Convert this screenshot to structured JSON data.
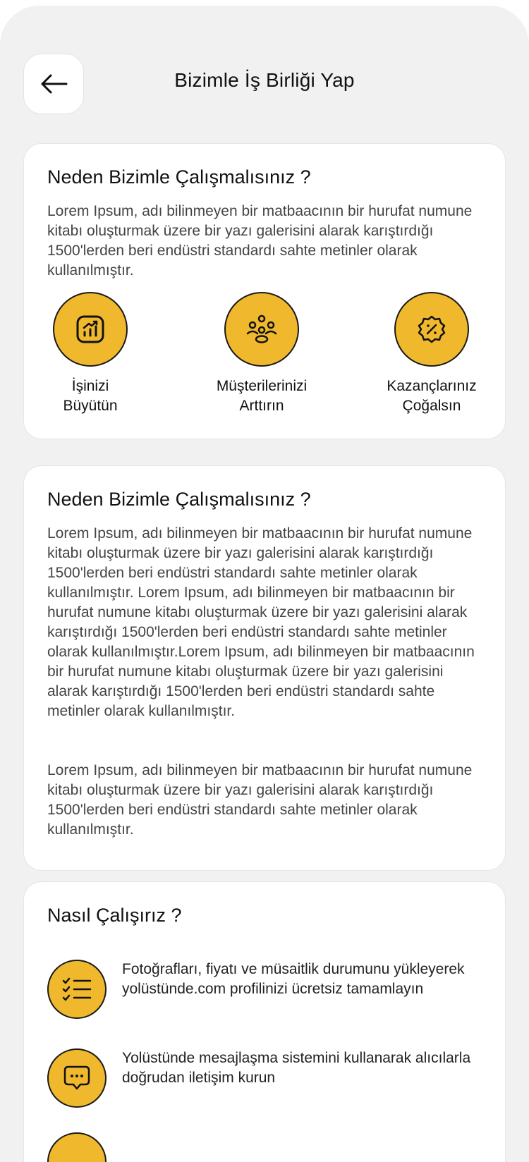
{
  "header": {
    "title": "Bizimle İş Birliği Yap",
    "back_icon": "arrow-left-icon"
  },
  "why_card": {
    "title": "Neden Bizimle Çalışmalısınız ?",
    "text": "Lorem Ipsum, adı bilinmeyen bir matbaacının bir hurufat numune kitabı oluşturmak üzere bir yazı galerisini alarak karıştırdığı 1500'lerden beri endüstri standardı sahte metinler olarak kullanılmıştır.",
    "features": [
      {
        "icon": "chart-growth-icon",
        "label_line1": "İşinizi",
        "label_line2": "Büyütün"
      },
      {
        "icon": "people-group-icon",
        "label_line1": "Müşterilerinizi",
        "label_line2": "Arttırın"
      },
      {
        "icon": "discount-badge-icon",
        "label_line1": "Kazançlarınız",
        "label_line2": "Çoğalsın"
      }
    ],
    "accent_color": "#f0b92d"
  },
  "details_card": {
    "title": "Neden Bizimle Çalışmalısınız ?",
    "paragraph1": "Lorem Ipsum, adı bilinmeyen bir matbaacının bir hurufat numune kitabı oluşturmak üzere bir yazı galerisini alarak karıştırdığı 1500'lerden beri endüstri standardı sahte metinler olarak kullanılmıştır. Lorem Ipsum, adı bilinmeyen bir matbaacının bir hurufat numune kitabı oluşturmak üzere bir yazı galerisini alarak karıştırdığı 1500'lerden beri endüstri standardı sahte metinler olarak kullanılmıştır.Lorem Ipsum, adı bilinmeyen bir matbaacının bir hurufat numune kitabı oluşturmak üzere bir yazı galerisini alarak karıştırdığı 1500'lerden beri endüstri standardı sahte metinler olarak kullanılmıştır.",
    "paragraph2": "Lorem Ipsum, adı bilinmeyen bir matbaacının bir hurufat numune kitabı oluşturmak üzere bir yazı galerisini alarak karıştırdığı 1500'lerden beri endüstri standardı sahte metinler olarak kullanılmıştır."
  },
  "how_card": {
    "title": "Nasıl Çalışırız ?",
    "steps": [
      {
        "icon": "checklist-icon",
        "text": "Fotoğrafları, fiyatı ve müsaitlik durumunu yükleyerek yolüstünde.com profilinizi ücretsiz tamamlayın"
      },
      {
        "icon": "chat-bubble-icon",
        "text": "Yolüstünde mesajlaşma sistemini kullanarak alıcılarla doğrudan iletişim kurun"
      }
    ]
  }
}
